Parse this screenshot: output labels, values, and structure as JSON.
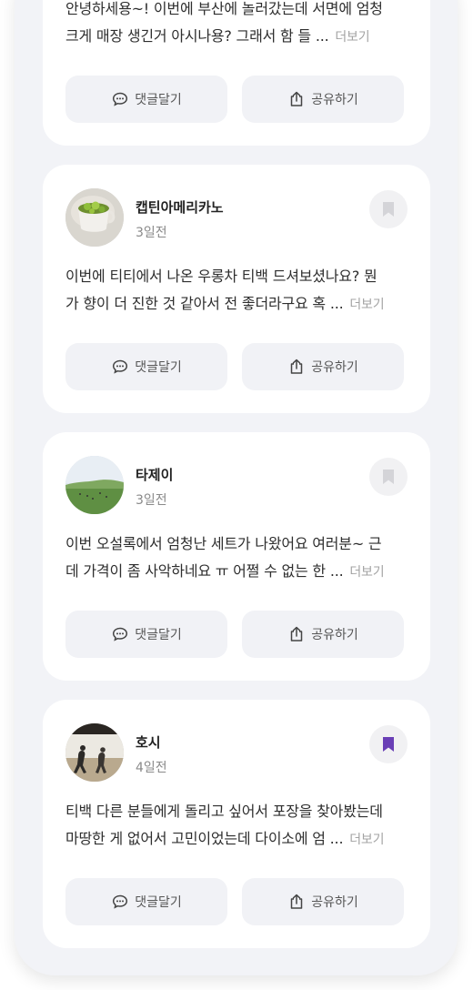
{
  "buttons": {
    "comment_label": "댓글달기",
    "share_label": "공유하기",
    "more_label": "더보기"
  },
  "posts": [
    {
      "text_line1": "안녕하세용~! 이번에 부산에 놀러갔는데 서면에 엄청",
      "text_line2": "크게 매장 생긴거 아시나용? 그래서 함 들 ..."
    },
    {
      "author": "캡틴아메리카노",
      "time": "3일전",
      "bookmarked": false,
      "avatar_icon": "green-tea-cup-photo",
      "text_line1": "이번에 티티에서 나온 우롱차 티백 드셔보셨나요? 뭔",
      "text_line2": "가 향이 더 진한 것 같아서 전 좋더라구요 혹 ..."
    },
    {
      "author": "타제이",
      "time": "3일전",
      "bookmarked": false,
      "avatar_icon": "green-field-landscape-photo",
      "text_line1": "이번 오설록에서 엄청난 세트가 나왔어요 여러분~ 근",
      "text_line2": "데 가격이 좀 사악하네요 ㅠ 어쩔 수 없는 한 ..."
    },
    {
      "author": "호시",
      "time": "4일전",
      "bookmarked": true,
      "avatar_icon": "people-outdoors-photo",
      "text_line1": "티백 다른 분들에게 돌리고 싶어서 포장을 찾아봤는데",
      "text_line2": "마땅한 게 없어서 고민이었는데 다이소에 엄 ..."
    }
  ],
  "colors": {
    "background": "#f2f3f7",
    "card": "#ffffff",
    "button_bg": "#f1f2f6",
    "bookmark_active": "#6a3fb6",
    "bookmark_inactive": "#d4d4d8",
    "muted_text": "#8a8a8a"
  }
}
